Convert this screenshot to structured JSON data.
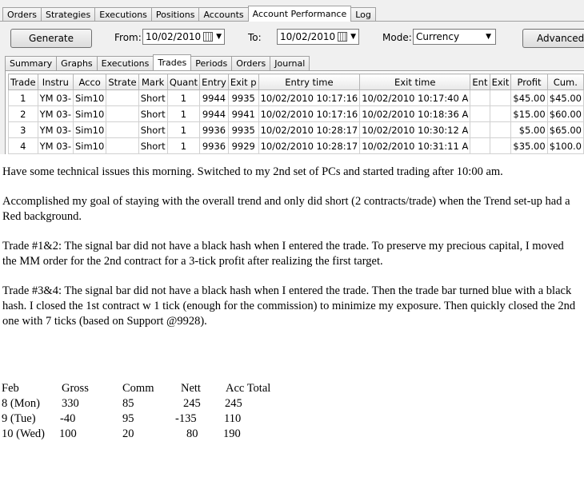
{
  "top_tabs": [
    "Orders",
    "Strategies",
    "Executions",
    "Positions",
    "Accounts",
    "Account Performance",
    "Log"
  ],
  "top_tab_active": 5,
  "toolbar": {
    "generate_label": "Generate",
    "from_label": "From:",
    "from_value": "10/02/2010",
    "to_label": "To:",
    "to_value": "10/02/2010",
    "mode_label": "Mode:",
    "mode_value": "Currency",
    "advanced_label": "Advanced >"
  },
  "sub_tabs": [
    "Summary",
    "Graphs",
    "Executions",
    "Trades",
    "Periods",
    "Orders",
    "Journal"
  ],
  "sub_tab_active": 3,
  "trades": {
    "headers": [
      "Trade",
      "Instru",
      "Acco",
      "Strate",
      "Mark",
      "Quant",
      "Entry",
      "Exit p",
      "Entry time",
      "Exit time",
      "Ent",
      "Exit",
      "Profit",
      "Cum."
    ],
    "rows": [
      [
        "1",
        "YM 03-",
        "Sim10",
        "",
        "Short",
        "1",
        "9944",
        "9935",
        "10/02/2010 10:17:16",
        "10/02/2010 10:17:40 A",
        "",
        "",
        "$45.00",
        "$45.00"
      ],
      [
        "2",
        "YM 03-",
        "Sim10",
        "",
        "Short",
        "1",
        "9944",
        "9941",
        "10/02/2010 10:17:16",
        "10/02/2010 10:18:36 A",
        "",
        "",
        "$15.00",
        "$60.00"
      ],
      [
        "3",
        "YM 03-",
        "Sim10",
        "",
        "Short",
        "1",
        "9936",
        "9935",
        "10/02/2010 10:28:17",
        "10/02/2010 10:30:12 A",
        "",
        "",
        "$5.00",
        "$65.00"
      ],
      [
        "4",
        "YM 03-",
        "Sim10",
        "",
        "Short",
        "1",
        "9936",
        "9929",
        "10/02/2010 10:28:17",
        "10/02/2010 10:31:11 A",
        "",
        "",
        "$35.00",
        "$100.0"
      ]
    ]
  },
  "notes": [
    "Have some technical issues this morning.  Switched to my 2nd set of PCs and started trading after 10:00 am.",
    "Accomplished my goal of staying with the overall trend and only did short (2 contracts/trade) when the Trend set-up had a Red background.",
    "Trade #1&2:  The signal bar did not have a black hash when I entered the trade.  To preserve my precious capital, I moved the MM order for the 2nd contract for a 3-tick profit after realizing the first target.",
    "Trade #3&4:  The signal bar did not have a black hash when I entered the trade.  Then the trade bar turned blue with a black hash.  I closed the 1st contract w 1 tick (enough for the commission) to minimize my exposure.  Then quickly closed the 2nd one with 7 ticks (based on Support @9928)."
  ],
  "summary": {
    "headers": [
      "Feb",
      "Gross",
      "Comm",
      "Nett",
      "Acc Total"
    ],
    "rows": [
      [
        "8 (Mon)",
        "330",
        "85",
        "245",
        "245"
      ],
      [
        "9 (Tue)",
        "-40",
        "95",
        "-135",
        "110"
      ],
      [
        "10 (Wed)",
        "100",
        "20",
        "80",
        "190"
      ]
    ]
  }
}
